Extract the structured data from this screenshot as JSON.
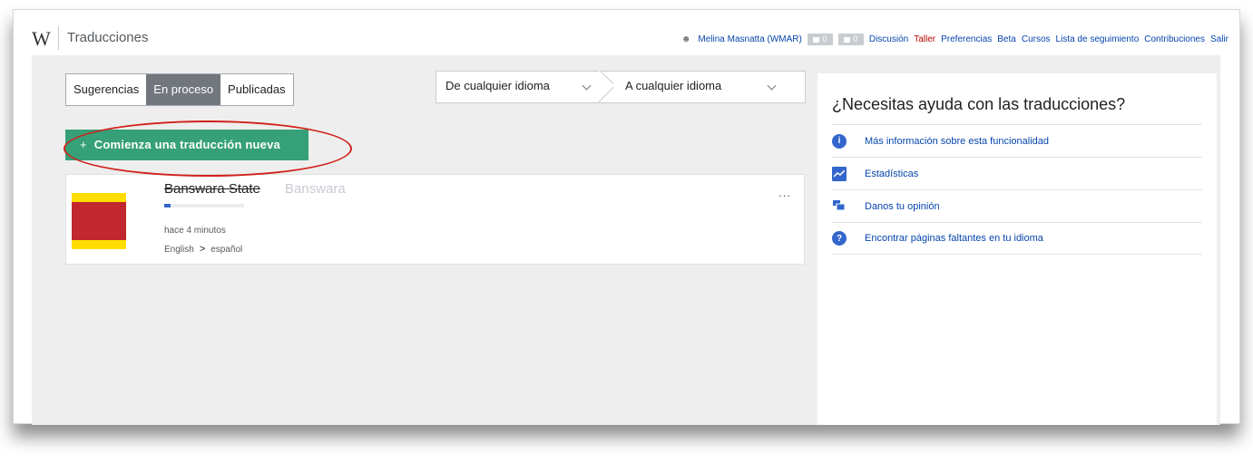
{
  "app": {
    "logo": "W",
    "title": "Traducciones"
  },
  "personal": {
    "user": "Melina Masnatta (WMAR)",
    "alerts_count": "0",
    "notices_count": "0",
    "links": [
      "Discusión",
      "Taller",
      "Preferencias",
      "Beta",
      "Cursos",
      "Lista de seguimiento",
      "Contribuciones",
      "Salir"
    ]
  },
  "tabs": [
    "Sugerencias",
    "En proceso",
    "Publicadas"
  ],
  "active_tab": "En proceso",
  "language_filter": {
    "source": "De cualquier idioma",
    "target": "A cualquier idioma"
  },
  "new_translation": {
    "plus": "+",
    "label": "Comienza una traducción nueva"
  },
  "translations": [
    {
      "title": "Banswara State",
      "target_title": "Banswara",
      "progress": 0.08,
      "time": "hace 4 minutos",
      "source_lang": "English",
      "arrow": ">",
      "target_lang": "español",
      "menu": "..."
    }
  ],
  "help": {
    "title": "¿Necesitas ayuda con las traducciones?",
    "items": [
      {
        "label": "Más información sobre esta funcionalidad",
        "icon": "info-icon"
      },
      {
        "label": "Estadísticas",
        "icon": "chart-icon"
      },
      {
        "label": "Danos tu opinión",
        "icon": "feedback-icon"
      },
      {
        "label": "Encontrar páginas faltantes en tu idioma",
        "icon": "help-icon"
      }
    ]
  },
  "colors": {
    "accent_green": "#36a078",
    "link_blue": "#0645ad",
    "annotation_red": "#d0221b",
    "active_tab": "#72777d"
  }
}
